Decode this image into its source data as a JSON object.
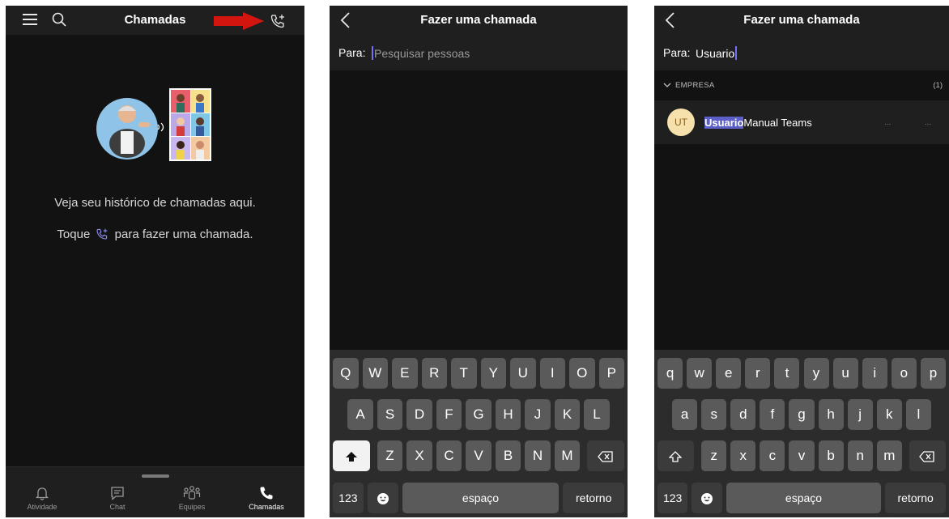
{
  "screen1": {
    "title": "Chamadas",
    "empty_line1": "Veja seu histórico de chamadas aqui.",
    "empty_line2_pre": "Toque",
    "empty_line2_post": "para fazer uma chamada.",
    "nav": [
      {
        "label": "Atividade",
        "icon": "bell-icon"
      },
      {
        "label": "Chat",
        "icon": "chat-icon"
      },
      {
        "label": "Equipes",
        "icon": "teams-icon"
      },
      {
        "label": "Chamadas",
        "icon": "phone-icon",
        "active": true
      }
    ],
    "accent_red": "#d2160f"
  },
  "screen2": {
    "title": "Fazer uma chamada",
    "para_label": "Para:",
    "placeholder": "Pesquisar pessoas",
    "keys_row1": [
      "Q",
      "W",
      "E",
      "R",
      "T",
      "Y",
      "U",
      "I",
      "O",
      "P"
    ],
    "keys_row2": [
      "A",
      "S",
      "D",
      "F",
      "G",
      "H",
      "J",
      "K",
      "L"
    ],
    "keys_row3": [
      "Z",
      "X",
      "C",
      "V",
      "B",
      "N",
      "M"
    ],
    "key_123": "123",
    "key_space": "espaço",
    "key_return": "retorno"
  },
  "screen3": {
    "title": "Fazer uma chamada",
    "para_label": "Para:",
    "query": "Usuario",
    "section_name": "EMPRESA",
    "section_count": "(1)",
    "result": {
      "initials": "UT",
      "name_match": "Usuario",
      "name_rest": "Manual Teams",
      "dots1": "...",
      "dots2": "..."
    },
    "keys_row1": [
      "q",
      "w",
      "e",
      "r",
      "t",
      "y",
      "u",
      "i",
      "o",
      "p"
    ],
    "keys_row2": [
      "a",
      "s",
      "d",
      "f",
      "g",
      "h",
      "j",
      "k",
      "l"
    ],
    "keys_row3": [
      "z",
      "x",
      "c",
      "v",
      "b",
      "n",
      "m"
    ],
    "key_123": "123",
    "key_space": "espaço",
    "key_return": "retorno"
  },
  "colors": {
    "highlight": "#5b5fc7",
    "caret": "#6d72f6",
    "avatar_bg": "#f6e1ad"
  }
}
